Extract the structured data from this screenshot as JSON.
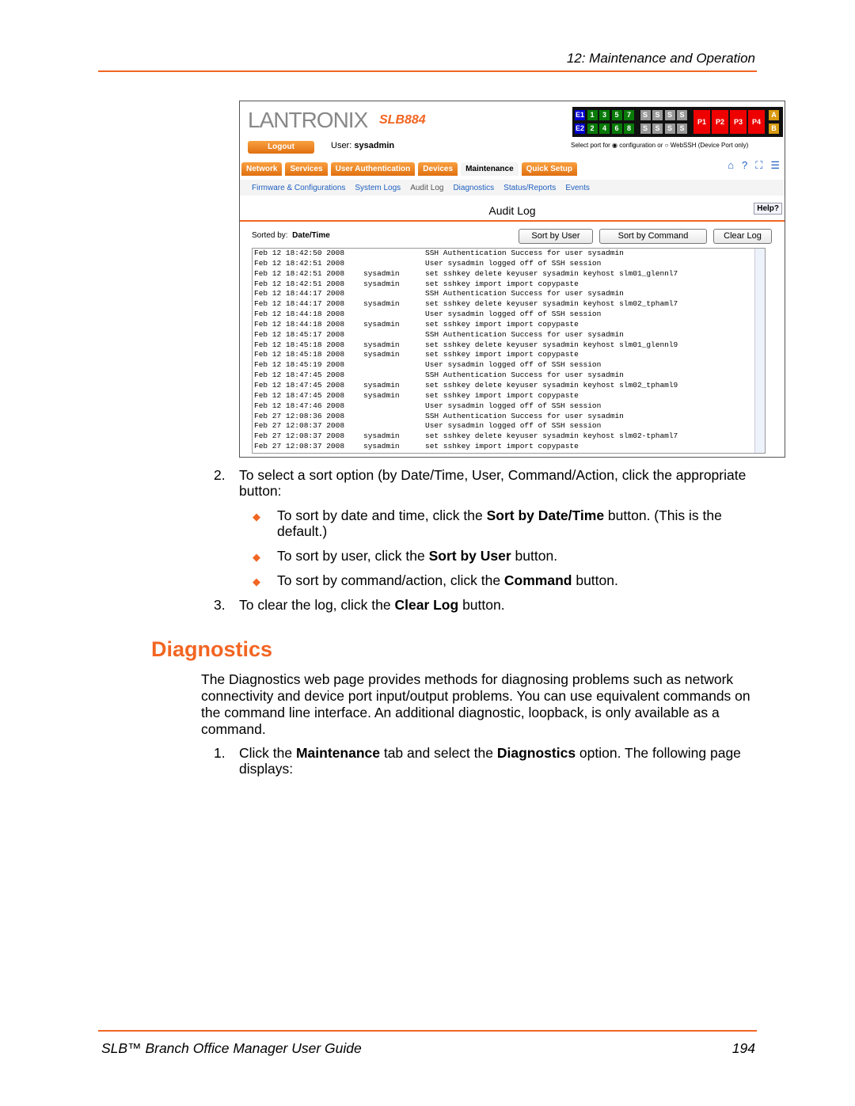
{
  "header": {
    "chapter": "12: Maintenance and Operation"
  },
  "screenshot": {
    "logo": "LANTRONIX",
    "model": "SLB884",
    "ports": {
      "top": [
        "E1",
        "1",
        "3",
        "5",
        "7",
        "S",
        "S",
        "S",
        "S"
      ],
      "bottom": [
        "E2",
        "2",
        "4",
        "6",
        "8",
        "S",
        "S",
        "S",
        "S"
      ],
      "power": [
        "P1",
        "P2",
        "P3",
        "P4"
      ],
      "ab": [
        "A",
        "B"
      ]
    },
    "logout": "Logout",
    "user_label": "User:",
    "user": "sysadmin",
    "select_port": "Select port for",
    "opt_config": "configuration or",
    "opt_webssh": "WebSSH (Device Port only)",
    "tabs": [
      "Network",
      "Services",
      "User Authentication",
      "Devices",
      "Maintenance",
      "Quick Setup"
    ],
    "subtabs": [
      "Firmware & Configurations",
      "System Logs",
      "Audit Log",
      "Diagnostics",
      "Status/Reports",
      "Events"
    ],
    "title": "Audit Log",
    "help": "Help?",
    "sorted_label": "Sorted by:",
    "sorted_value": "Date/Time",
    "buttons": {
      "sort_user": "Sort by User",
      "sort_command": "Sort by Command",
      "clear": "Clear Log"
    },
    "log": [
      [
        "Feb 12 18:42:50 2008",
        "",
        "SSH Authentication Success for user sysadmin"
      ],
      [
        "Feb 12 18:42:51 2008",
        "",
        "User sysadmin logged off of SSH session"
      ],
      [
        "Feb 12 18:42:51 2008",
        "sysadmin",
        "set sshkey delete keyuser sysadmin keyhost slm01_glennl7"
      ],
      [
        "Feb 12 18:42:51 2008",
        "sysadmin",
        "set sshkey import import copypaste"
      ],
      [
        "Feb 12 18:44:17 2008",
        "",
        "SSH Authentication Success for user sysadmin"
      ],
      [
        "Feb 12 18:44:17 2008",
        "sysadmin",
        "set sshkey delete keyuser sysadmin keyhost slm02_tphaml7"
      ],
      [
        "Feb 12 18:44:18 2008",
        "",
        "User sysadmin logged off of SSH session"
      ],
      [
        "Feb 12 18:44:18 2008",
        "sysadmin",
        "set sshkey import import copypaste"
      ],
      [
        "Feb 12 18:45:17 2008",
        "",
        "SSH Authentication Success for user sysadmin"
      ],
      [
        "Feb 12 18:45:18 2008",
        "sysadmin",
        "set sshkey delete keyuser sysadmin keyhost slm01_glennl9"
      ],
      [
        "Feb 12 18:45:18 2008",
        "sysadmin",
        "set sshkey import import copypaste"
      ],
      [
        "Feb 12 18:45:19 2008",
        "",
        "User sysadmin logged off of SSH session"
      ],
      [
        "Feb 12 18:47:45 2008",
        "",
        "SSH Authentication Success for user sysadmin"
      ],
      [
        "Feb 12 18:47:45 2008",
        "sysadmin",
        "set sshkey delete keyuser sysadmin keyhost slm02_tphaml9"
      ],
      [
        "Feb 12 18:47:45 2008",
        "sysadmin",
        "set sshkey import import copypaste"
      ],
      [
        "Feb 12 18:47:46 2008",
        "",
        "User sysadmin logged off of SSH session"
      ],
      [
        "Feb 27 12:08:36 2008",
        "",
        "SSH Authentication Success for user sysadmin"
      ],
      [
        "Feb 27 12:08:37 2008",
        "",
        "User sysadmin logged off of SSH session"
      ],
      [
        "Feb 27 12:08:37 2008",
        "sysadmin",
        "set sshkey delete keyuser sysadmin keyhost slm02-tphaml7"
      ],
      [
        "Feb 27 12:08:37 2008",
        "sysadmin",
        "set sshkey import import copypaste"
      ]
    ]
  },
  "steps": {
    "s2_num": "2.",
    "s2_a": "To select a sort option (by Date/Time, User, Command/Action, click the appropriate",
    "s2_b": "button:",
    "b1_a": "To sort by date and time, click the ",
    "b1_bold": "Sort by Date/Time",
    "b1_b": " button. (This is the",
    "b1_c": "default.)",
    "b2_a": "To sort by user, click the ",
    "b2_bold": "Sort by User",
    "b2_b": " button.",
    "b3_a": "To sort by command/action, click the ",
    "b3_bold": "Command",
    "b3_b": " button.",
    "s3_num": "3.",
    "s3_a": "To clear the log, click the ",
    "s3_bold": "Clear Log",
    "s3_b": " button."
  },
  "diagnostics": {
    "heading": "Diagnostics",
    "p1": "The Diagnostics web page provides methods for diagnosing problems such as network connectivity and device port input/output problems. You can use equivalent commands on the command line interface. An additional diagnostic, loopback, is only available as a command.",
    "s1_num": "1.",
    "s1_a": "Click the ",
    "s1_b1": "Maintenance",
    "s1_b": " tab and select the ",
    "s1_b2": "Diagnostics",
    "s1_c": " option. The following page",
    "s1_d": "displays:"
  },
  "footer": {
    "title": "SLB™ Branch Office Manager User Guide",
    "page": "194"
  },
  "colors": {
    "accent": "#f26522",
    "link": "#1f5fbf"
  }
}
